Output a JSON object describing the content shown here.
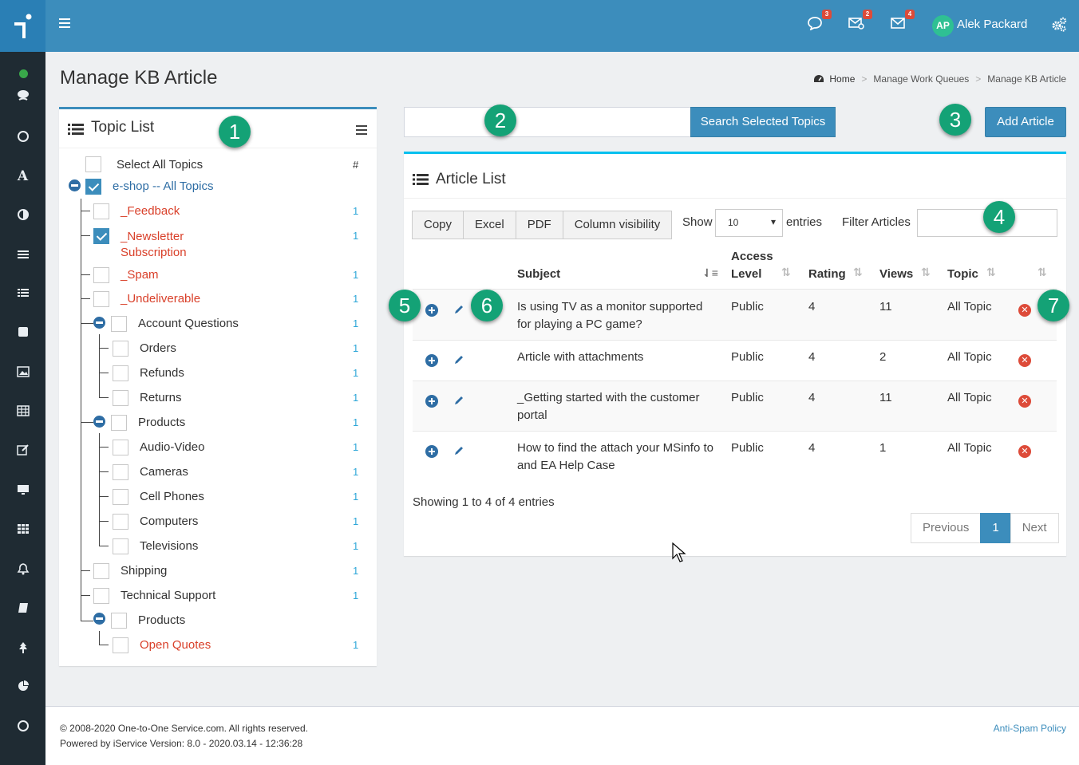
{
  "header": {
    "user_initials": "AP",
    "user_name": "Alek Packard",
    "badges": {
      "chat": "3",
      "envelope_cog": "2",
      "mail": "4"
    }
  },
  "page": {
    "title": "Manage KB Article",
    "breadcrumb": [
      "Home",
      "Manage Work Queues",
      "Manage KB Article"
    ]
  },
  "topic_list": {
    "title": "Topic List",
    "select_all_label": "Select All Topics",
    "count_header": "#",
    "items": [
      {
        "label": "e-shop -- All Topics",
        "count": ""
      },
      {
        "label": "_Feedback",
        "count": "1"
      },
      {
        "label": "_Newsletter Subscription",
        "count": "1"
      },
      {
        "label": "_Spam",
        "count": "1"
      },
      {
        "label": "_Undeliverable",
        "count": "1"
      },
      {
        "label": "Account Questions",
        "count": "1"
      },
      {
        "label": "Orders",
        "count": "1"
      },
      {
        "label": "Refunds",
        "count": "1"
      },
      {
        "label": "Returns",
        "count": "1"
      },
      {
        "label": "Products",
        "count": "1"
      },
      {
        "label": "Audio-Video",
        "count": "1"
      },
      {
        "label": "Cameras",
        "count": "1"
      },
      {
        "label": "Cell Phones",
        "count": "1"
      },
      {
        "label": "Computers",
        "count": "1"
      },
      {
        "label": "Televisions",
        "count": "1"
      },
      {
        "label": "Shipping",
        "count": "1"
      },
      {
        "label": "Technical Support",
        "count": "1"
      },
      {
        "label": "Products",
        "count": ""
      },
      {
        "label": "Open Quotes",
        "count": "1"
      }
    ]
  },
  "search": {
    "placeholder": "",
    "button_label": "Search Selected Topics",
    "add_button_label": "Add Article"
  },
  "article_list": {
    "title": "Article List",
    "export_buttons": [
      "Copy",
      "Excel",
      "PDF",
      "Column visibility"
    ],
    "show_label": "Show",
    "page_size": "10",
    "entries_label": "entries",
    "filter_label": "Filter Articles",
    "columns": {
      "subject": "Subject",
      "access_level_line1": "Access",
      "access_level_line2": "Level",
      "rating": "Rating",
      "views": "Views",
      "topic": "Topic"
    },
    "rows": [
      {
        "subject_line1": "Is using TV as a monitor supported",
        "subject_line2": "for playing a PC game?",
        "access": "Public",
        "rating": "4",
        "views": "11",
        "topic": "All Topic"
      },
      {
        "subject_line1": "Article with attachments",
        "subject_line2": "",
        "access": "Public",
        "rating": "4",
        "views": "2",
        "topic": "All Topic"
      },
      {
        "subject_line1": "_Getting started with the customer",
        "subject_line2": "portal",
        "access": "Public",
        "rating": "4",
        "views": "11",
        "topic": "All Topic"
      },
      {
        "subject_line1": "How to find the attach your MSinfo to",
        "subject_line2": "and EA Help Case",
        "access": "Public",
        "rating": "4",
        "views": "1",
        "topic": "All Topic"
      }
    ],
    "info": "Showing 1 to 4 of 4 entries",
    "pagination": {
      "previous": "Previous",
      "current": "1",
      "next": "Next"
    }
  },
  "callouts": [
    "1",
    "2",
    "3",
    "4",
    "5",
    "6",
    "7"
  ],
  "footer": {
    "copyright": "© 2008-2020 One-to-One Service.com. All rights reserved.",
    "version": "Powered by iService Version: 8.0 - 2020.03.14 - 12:36:28",
    "link": "Anti-Spam Policy"
  },
  "colors": {
    "primary": "#3c8dbc",
    "sidebar": "#1f2b33",
    "callout": "#14a276",
    "danger": "#dd4b39",
    "topic_red": "#d9402a",
    "count_blue": "#2ea7d8"
  }
}
